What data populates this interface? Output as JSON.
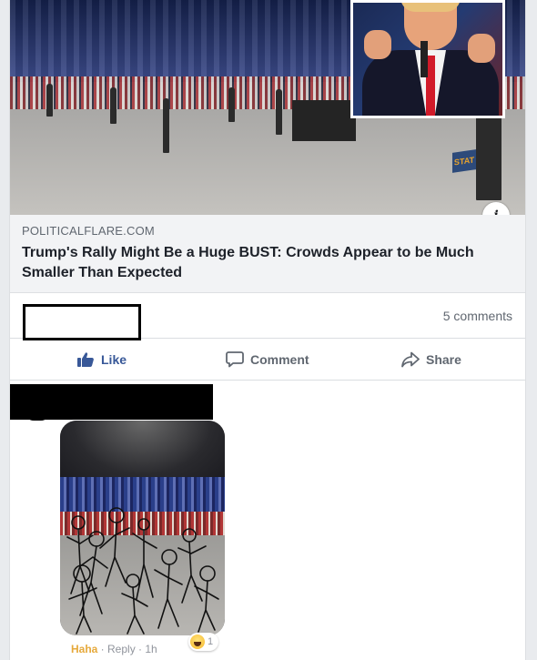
{
  "link": {
    "source": "POLITICALFLARE.COM",
    "headline": "Trump's Rally Might Be a Huge BUST: Crowds Appear to be Much Smaller Than Expected",
    "info_icon": "i",
    "preview_banner_text": "STAT"
  },
  "stats": {
    "comments": "5 comments"
  },
  "actions": {
    "like": "Like",
    "comment": "Comment",
    "share": "Share"
  },
  "comment": {
    "reaction_label": "Haha",
    "separator_1": " · ",
    "reply_label": "Reply",
    "separator_2": " · ",
    "time": "1h",
    "reaction_count": "1",
    "reaction_icon": "haha-emoji-icon"
  },
  "colors": {
    "like_blue": "#385898",
    "haha_yellow": "#e6a93b",
    "meta_gray": "#606770"
  }
}
